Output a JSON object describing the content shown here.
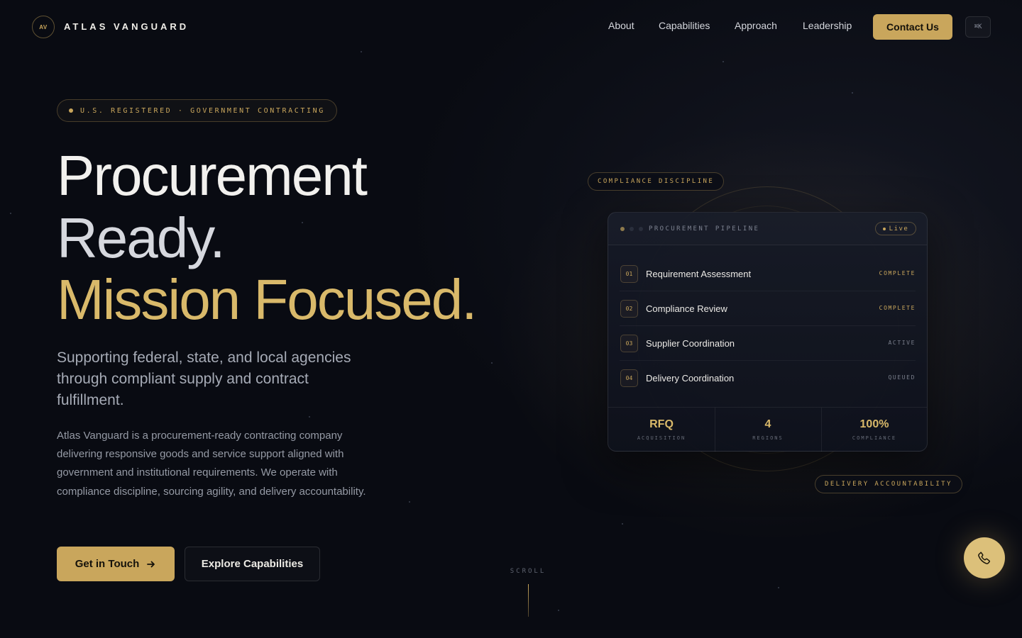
{
  "brand": {
    "monogram": "AV",
    "name": "ATLAS VANGUARD"
  },
  "nav": {
    "items": [
      "About",
      "Capabilities",
      "Approach",
      "Leadership"
    ],
    "contact_label": "Contact Us",
    "shortcut_label": "⌘K"
  },
  "hero": {
    "badge": "U.S. REGISTERED · GOVERNMENT CONTRACTING",
    "headline_line1": "Procurement",
    "headline_line2": "Ready.",
    "headline_line3": "Mission Focused.",
    "subheadline": "Supporting federal, state, and local agencies through compliant supply and contract fulfillment.",
    "description": "Atlas Vanguard is a procurement-ready contracting company delivering responsive goods and service support aligned with government and institutional requirements. We operate with compliance discipline, sourcing agility, and delivery accountability.",
    "primary_cta": "Get in Touch",
    "secondary_cta": "Explore Capabilities",
    "scroll_label": "SCROLL"
  },
  "pipeline": {
    "tag_top": "COMPLIANCE DISCIPLINE",
    "tag_bottom": "DELIVERY ACCOUNTABILITY",
    "title": "PROCUREMENT PIPELINE",
    "live_label": "Live",
    "steps": [
      {
        "num": "01",
        "name": "Requirement Assessment",
        "status": "COMPLETE"
      },
      {
        "num": "02",
        "name": "Compliance Review",
        "status": "COMPLETE"
      },
      {
        "num": "03",
        "name": "Supplier Coordination",
        "status": "ACTIVE"
      },
      {
        "num": "04",
        "name": "Delivery Coordination",
        "status": "QUEUED"
      }
    ],
    "stats": [
      {
        "value": "RFQ",
        "label": "ACQUISITION"
      },
      {
        "value": "4",
        "label": "REGIONS"
      },
      {
        "value": "100%",
        "label": "COMPLIANCE"
      }
    ]
  },
  "colors": {
    "accent": "#c9a65c",
    "background": "#090b12",
    "status_done": "#c9a65c",
    "status_pending": "#7a7f8c"
  }
}
